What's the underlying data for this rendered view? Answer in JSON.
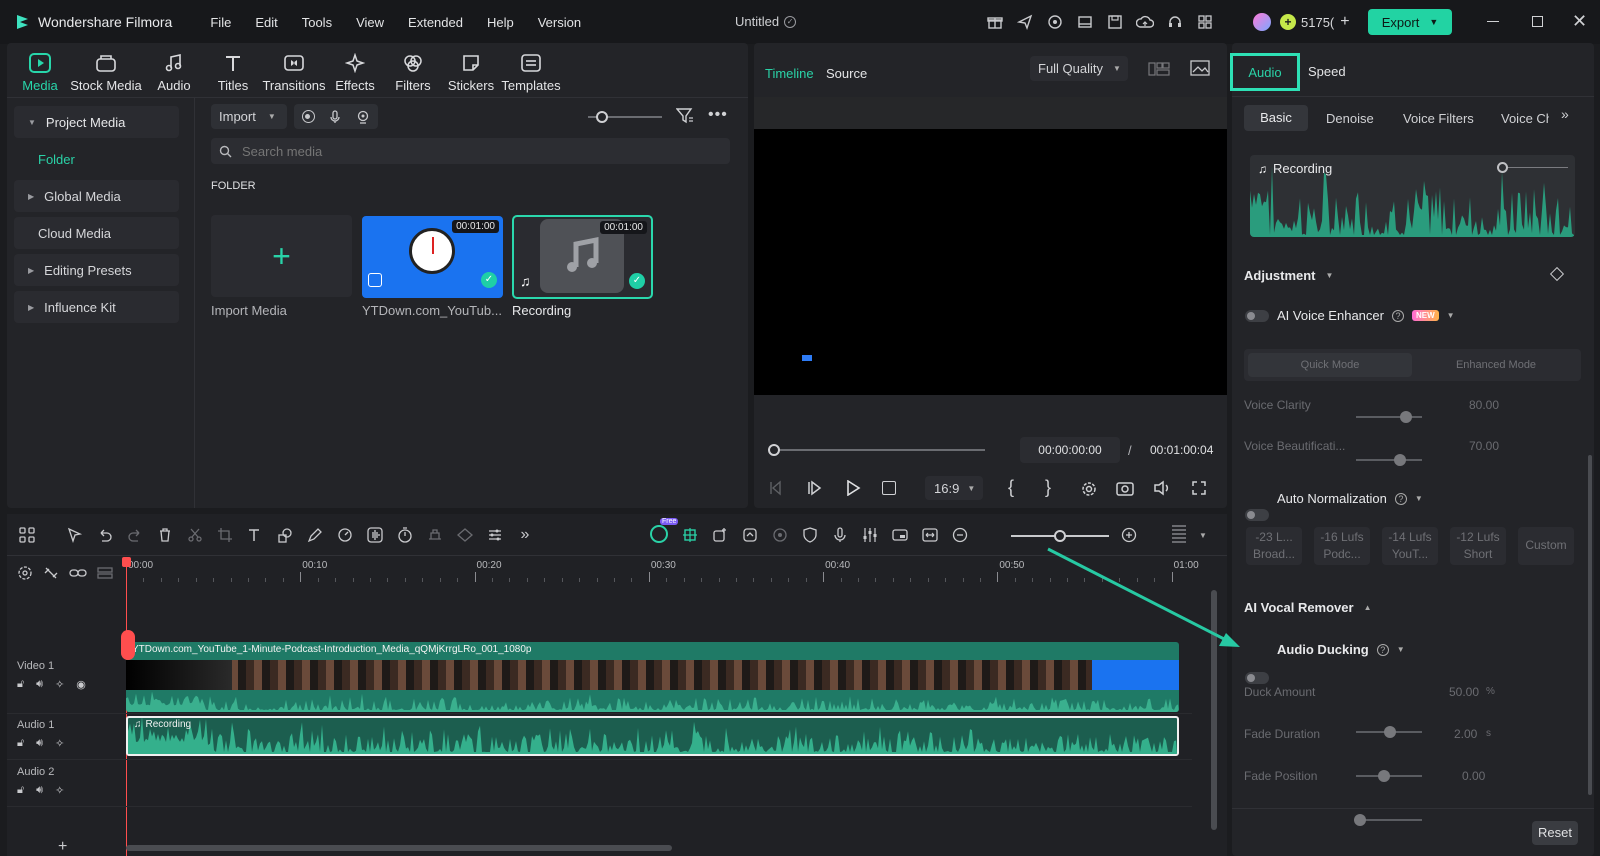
{
  "app": {
    "name": "Wondershare Filmora",
    "project_title": "Untitled",
    "credits": "5175(",
    "export_label": "Export"
  },
  "menu": [
    "File",
    "Edit",
    "Tools",
    "View",
    "Extended",
    "Help",
    "Version"
  ],
  "media_tabs": [
    "Media",
    "Stock Media",
    "Audio",
    "Titles",
    "Transitions",
    "Effects",
    "Filters",
    "Stickers",
    "Templates"
  ],
  "sidebar": {
    "items": [
      {
        "label": "Project Media",
        "expanded": true
      },
      {
        "label": "Folder"
      },
      {
        "label": "Global Media"
      },
      {
        "label": "Cloud Media"
      },
      {
        "label": "Editing Presets"
      },
      {
        "label": "Influence Kit"
      }
    ]
  },
  "media": {
    "import_label": "Import",
    "search_placeholder": "Search media",
    "folder_heading": "FOLDER",
    "import_media_label": "Import Media",
    "items": [
      {
        "name": "YTDown.com_YouTub...",
        "duration": "00:01:00"
      },
      {
        "name": "Recording",
        "duration": "00:01:00"
      }
    ]
  },
  "player": {
    "tabs": [
      "Timeline",
      "Source"
    ],
    "quality": "Full Quality",
    "current_time": "00:00:00:00",
    "separator": "/",
    "total_time": "00:01:00:04",
    "aspect": "16:9"
  },
  "right_panel": {
    "tabs": [
      "Audio",
      "Speed"
    ],
    "subtabs": [
      "Basic",
      "Denoise",
      "Voice Filters",
      "Voice Ch"
    ],
    "waveform_label": "Recording",
    "adjustment_label": "Adjustment",
    "ai_voice_enhancer": "AI Voice Enhancer",
    "new_badge": "NEW",
    "modes": [
      "Quick Mode",
      "Enhanced Mode"
    ],
    "voice_clarity": {
      "label": "Voice Clarity",
      "value": "80.00"
    },
    "voice_beautification": {
      "label": "Voice Beautificati...",
      "value": "70.00"
    },
    "auto_normalization": "Auto Normalization",
    "presets": [
      {
        "line1": "-23 L...",
        "line2": "Broad..."
      },
      {
        "line1": "-16 Lufs",
        "line2": "Podc..."
      },
      {
        "line1": "-14 Lufs",
        "line2": "YouT..."
      },
      {
        "line1": "-12 Lufs",
        "line2": "Short"
      },
      {
        "line1": "Custom",
        "line2": ""
      }
    ],
    "ai_vocal_remover": "AI Vocal Remover",
    "audio_ducking": "Audio Ducking",
    "duck_amount": {
      "label": "Duck Amount",
      "value": "50.00",
      "unit": "%"
    },
    "fade_duration": {
      "label": "Fade Duration",
      "value": "2.00",
      "unit": "s"
    },
    "fade_position": {
      "label": "Fade Position",
      "value": "0.00"
    },
    "reset_label": "Reset"
  },
  "timeline": {
    "ai_badge": "Free",
    "ruler": [
      "00:00",
      "00:10",
      "00:20",
      "00:30",
      "00:40",
      "00:50",
      "01:00"
    ],
    "tracks": [
      {
        "name": "Video 1"
      },
      {
        "name": "Audio 1"
      },
      {
        "name": "Audio 2"
      }
    ],
    "video_clip_name": "YTDown.com_YouTube_1-Minute-Podcast-Introduction_Media_qQMjKrrgLRo_001_1080p",
    "audio_clip_name": "Recording"
  },
  "colors": {
    "accent": "#1fcfa6",
    "background": "#1b1c1f",
    "panel": "#232428"
  }
}
